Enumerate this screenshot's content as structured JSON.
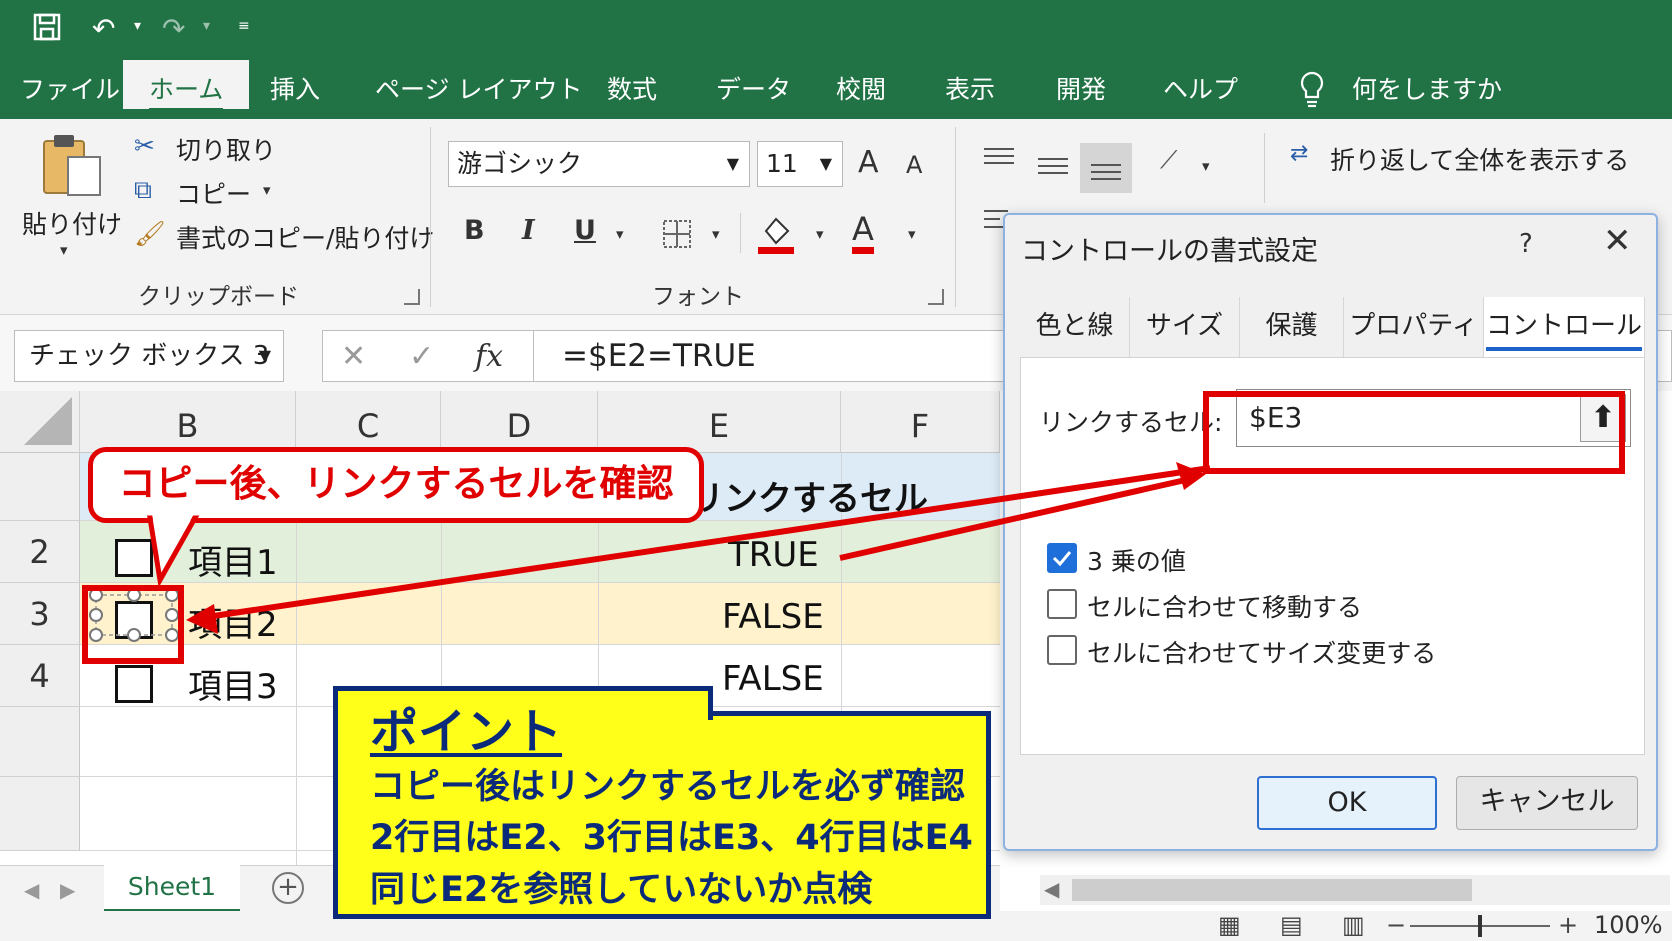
{
  "tabs": [
    "ファイル",
    "ホーム",
    "挿入",
    "ページ レイアウト",
    "数式",
    "データ",
    "校閲",
    "表示",
    "開発",
    "ヘルプ"
  ],
  "tell_me": "何をしますか",
  "clipboard": {
    "paste": "貼り付け",
    "cut": "切り取り",
    "copy": "コピー",
    "format_painter": "書式のコピー/貼り付け",
    "group_label": "クリップボード"
  },
  "font": {
    "name": "游ゴシック",
    "size": "11",
    "bold": "B",
    "italic": "I",
    "underline": "U",
    "group_label": "フォント",
    "grow": "A",
    "shrink": "A",
    "color_letter": "A"
  },
  "alignment": {
    "wrap_text": "折り返して全体を表示する"
  },
  "formula_bar": {
    "name_box": "チェック ボックス 3",
    "cancel": "✕",
    "enter": "✓",
    "fx": "fx",
    "formula": "=$E2=TRUE"
  },
  "columns": [
    "B",
    "C",
    "D",
    "E",
    "F"
  ],
  "rows": [
    {
      "num": "",
      "label": "",
      "value": "リンクするセル"
    },
    {
      "num": "2",
      "label": "項目1",
      "value": "TRUE"
    },
    {
      "num": "3",
      "label": "項目2",
      "value": "FALSE"
    },
    {
      "num": "4",
      "label": "項目3",
      "value": "FALSE"
    }
  ],
  "sheet_tab": "Sheet1",
  "status": {
    "zoom": "100%",
    "minus": "−",
    "plus": "+"
  },
  "dialog": {
    "title": "コントロールの書式設定",
    "help": "?",
    "close": "✕",
    "tabs": [
      "色と線",
      "サイズ",
      "保護",
      "プロパティ",
      "コントロール"
    ],
    "link_label": "リンクするセル:",
    "link_value": "$E3",
    "options": [
      {
        "label": "3 乗の値",
        "checked": true
      },
      {
        "label": "セルに合わせて移動する",
        "checked": false
      },
      {
        "label": "セルに合わせてサイズ変更する",
        "checked": false
      }
    ],
    "ok": "OK",
    "cancel": "キャンセル"
  },
  "annotations": {
    "callout": "コピー後、リンクするセルを確認",
    "point_title": "ポイント",
    "point_lines": [
      "コピー後はリンクするセルを必ず確認",
      "2行目はE2、3行目はE3、4行目はE4",
      "同じE2を参照していないか点検"
    ]
  },
  "colors": {
    "excel_green": "#217346",
    "annotation_red": "#e10000",
    "point_yellow": "#ffff1a",
    "point_navy": "#0b2b7a",
    "row2_green": "#e2efda",
    "row3_yellow": "#fff2cc",
    "header_blue": "#ddebf7"
  }
}
